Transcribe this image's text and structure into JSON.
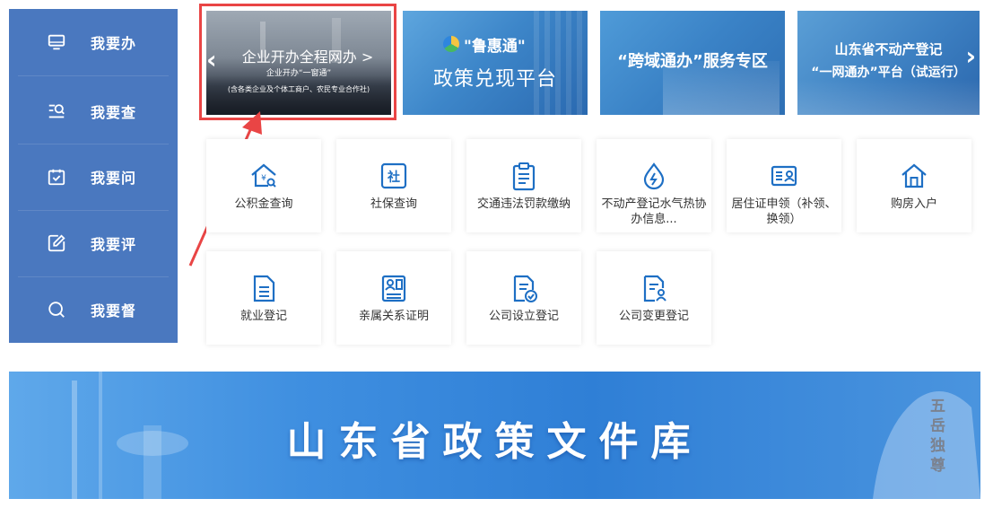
{
  "sidebar": {
    "items": [
      {
        "label": "我要办",
        "icon": "monitor-icon"
      },
      {
        "label": "我要查",
        "icon": "list-search-icon"
      },
      {
        "label": "我要问",
        "icon": "calendar-check-icon"
      },
      {
        "label": "我要评",
        "icon": "edit-icon"
      },
      {
        "label": "我要督",
        "icon": "search-icon"
      }
    ]
  },
  "banners": {
    "b1": {
      "title": "企业开办全程网办 >",
      "sub": "企业开办“一窗通”",
      "note": "(含各类企业及个体工商户、农民专业合作社)"
    },
    "b2": {
      "title": "\"鲁惠通\"",
      "sub": "政策兑现平台"
    },
    "b3": {
      "title": "“跨域通办”服务专区"
    },
    "b4": {
      "title": "山东省不动产登记",
      "sub": "“一网通办”平台（试运行）"
    }
  },
  "services": [
    {
      "label": "公积金查询",
      "icon": "housing-fund-icon"
    },
    {
      "label": "社保查询",
      "icon": "social-security-icon"
    },
    {
      "label": "交通违法罚款缴纳",
      "icon": "clipboard-icon"
    },
    {
      "label": "不动产登记水气热协办信息...",
      "icon": "water-drop-icon"
    },
    {
      "label": "居住证申领（补领、换领）",
      "icon": "id-card-icon"
    },
    {
      "label": "购房入户",
      "icon": "house-icon"
    },
    {
      "label": "就业登记",
      "icon": "document-icon"
    },
    {
      "label": "亲属关系证明",
      "icon": "profile-card-icon"
    },
    {
      "label": "公司设立登记",
      "icon": "document-check-icon"
    },
    {
      "label": "公司变更登记",
      "icon": "document-user-icon"
    }
  ],
  "library": {
    "title": "山东省政策文件库",
    "stamp": "五岳独尊"
  },
  "colors": {
    "sidebar": "#4a78bf",
    "accent": "#1e6fc4",
    "highlight": "#e94545"
  }
}
